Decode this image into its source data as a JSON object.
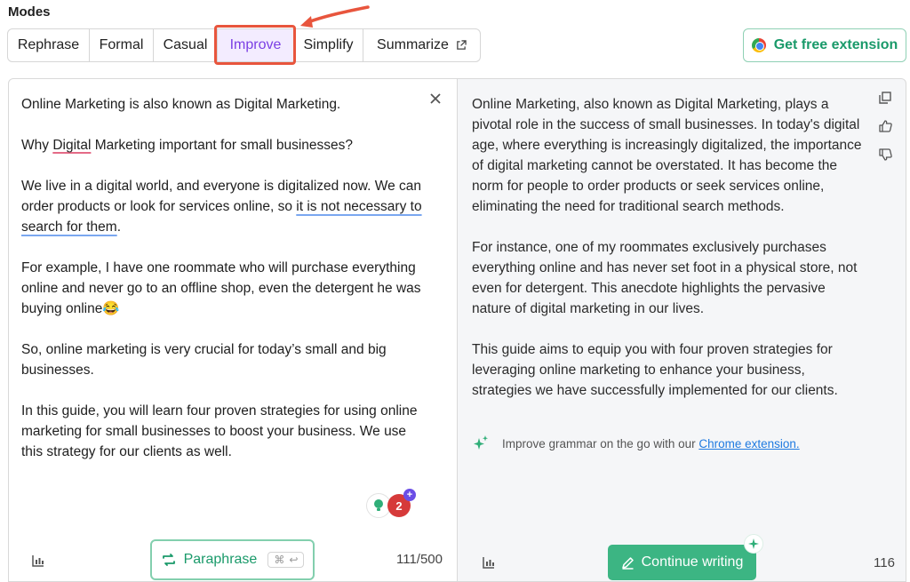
{
  "modes": {
    "title": "Modes",
    "items": [
      {
        "label": "Rephrase"
      },
      {
        "label": "Formal"
      },
      {
        "label": "Casual"
      },
      {
        "label": "Improve"
      },
      {
        "label": "Simplify"
      },
      {
        "label": "Summarize"
      }
    ],
    "active": "Improve"
  },
  "extension_button": {
    "label": "Get free extension"
  },
  "input": {
    "paragraphs": {
      "p1": "Online Marketing is also known as Digital Marketing.",
      "p2_a": "Why ",
      "p2_b": "Digital",
      "p2_c": " Marketing important for small businesses?",
      "p3_a": "We live in a digital world, and everyone is digitalized now. We can order products or look for services online, so ",
      "p3_b": "it is not necessary to search for them",
      "p3_c": ".",
      "p4": "For example, I have one roommate who will purchase everything online and never go to an offline shop, even the detergent he was buying online😂",
      "p5": "So, online marketing is very crucial for today’s small and big businesses.",
      "p6": "In this guide, you will learn four proven strategies for using online marketing for small businesses to boost your business. We use this strategy for our clients as well."
    },
    "issue_count": "2",
    "paraphrase_label": "Paraphrase",
    "shortcut_cmd": "⌘",
    "shortcut_enter": "↩",
    "counter": "111/500"
  },
  "output": {
    "paragraphs": {
      "p1": "Online Marketing, also known as Digital Marketing, plays a pivotal role in the success of small businesses. In today's digital age, where everything is increasingly digitalized, the importance of digital marketing cannot be overstated. It has become the norm for people to order products or seek services online, eliminating the need for traditional search methods.",
      "p2": "For instance, one of my roommates exclusively purchases everything online and has never set foot in a physical store, not even for detergent. This anecdote highlights the pervasive nature of digital marketing in our lives.",
      "p3": "This guide aims to equip you with four proven strategies for leveraging online marketing to enhance your business, strategies we have successfully implemented for our clients."
    },
    "tip_text": "Improve grammar on the go with our ",
    "tip_link": "Chrome extension.",
    "continue_label": "Continue writing",
    "counter": "116"
  },
  "colors": {
    "accent_green": "#3cb583",
    "active_mode": "#7b3fe4",
    "annotation_red": "#e8553d"
  }
}
